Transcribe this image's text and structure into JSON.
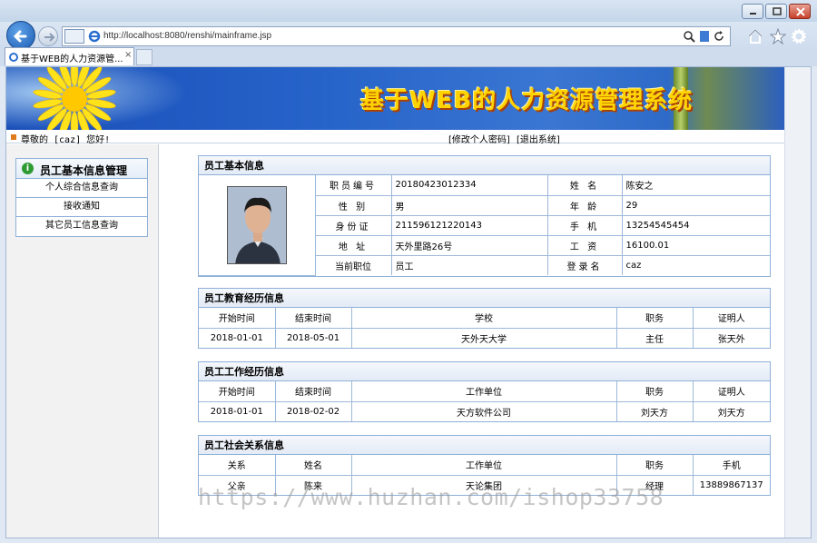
{
  "browser": {
    "address": "http://localhost:8080/renshi/mainframe.jsp",
    "tab_title": "基于WEB的人力资源管...",
    "tab_close": "×"
  },
  "banner": {
    "title": "基于WEB的人力资源管理系统"
  },
  "header": {
    "welcome": "尊敬的 [caz] 您好!",
    "change_password": "[修改个人密码]",
    "logout": "[退出系统]"
  },
  "sidebar": {
    "title": "员工基本信息管理",
    "items": [
      {
        "label": "个人综合信息查询"
      },
      {
        "label": "接收通知"
      },
      {
        "label": "其它员工信息查询"
      }
    ]
  },
  "basic": {
    "title": "员工基本信息",
    "rows": [
      {
        "l1": "职员编号",
        "v1": "20180423012334",
        "l2": "姓  名",
        "v2": "陈安之"
      },
      {
        "l1": "性  别",
        "v1": "男",
        "l2": "年  龄",
        "v2": "29"
      },
      {
        "l1": "身份证",
        "v1": "211596121220143",
        "l2": "手  机",
        "v2": "13254545454"
      },
      {
        "l1": "地  址",
        "v1": "天外里路26号",
        "l2": "工  资",
        "v2": "16100.01"
      },
      {
        "l1": "当前职位",
        "v1": "员工",
        "l2": "登录名",
        "v2": "caz"
      }
    ]
  },
  "education": {
    "title": "员工教育经历信息",
    "headers": [
      "开始时间",
      "结束时间",
      "学校",
      "职务",
      "证明人"
    ],
    "rows": [
      [
        "2018-01-01",
        "2018-05-01",
        "天外天大学",
        "主任",
        "张天外"
      ]
    ]
  },
  "work": {
    "title": "员工工作经历信息",
    "headers": [
      "开始时间",
      "结束时间",
      "工作单位",
      "职务",
      "证明人"
    ],
    "rows": [
      [
        "2018-01-01",
        "2018-02-02",
        "天方软件公司",
        "刘天方",
        "刘天方"
      ]
    ]
  },
  "social": {
    "title": "员工社会关系信息",
    "headers": [
      "关系",
      "姓名",
      "工作单位",
      "职务",
      "手机"
    ],
    "rows": [
      [
        "父亲",
        "陈来",
        "天论集团",
        "经理",
        "13889867137"
      ]
    ]
  },
  "watermark": "https://www.huzhan.com/ishop33758",
  "colors": {
    "border": "#8fb0d8",
    "banner_title": "#ffd400",
    "banner_bg": "#2663c9"
  }
}
